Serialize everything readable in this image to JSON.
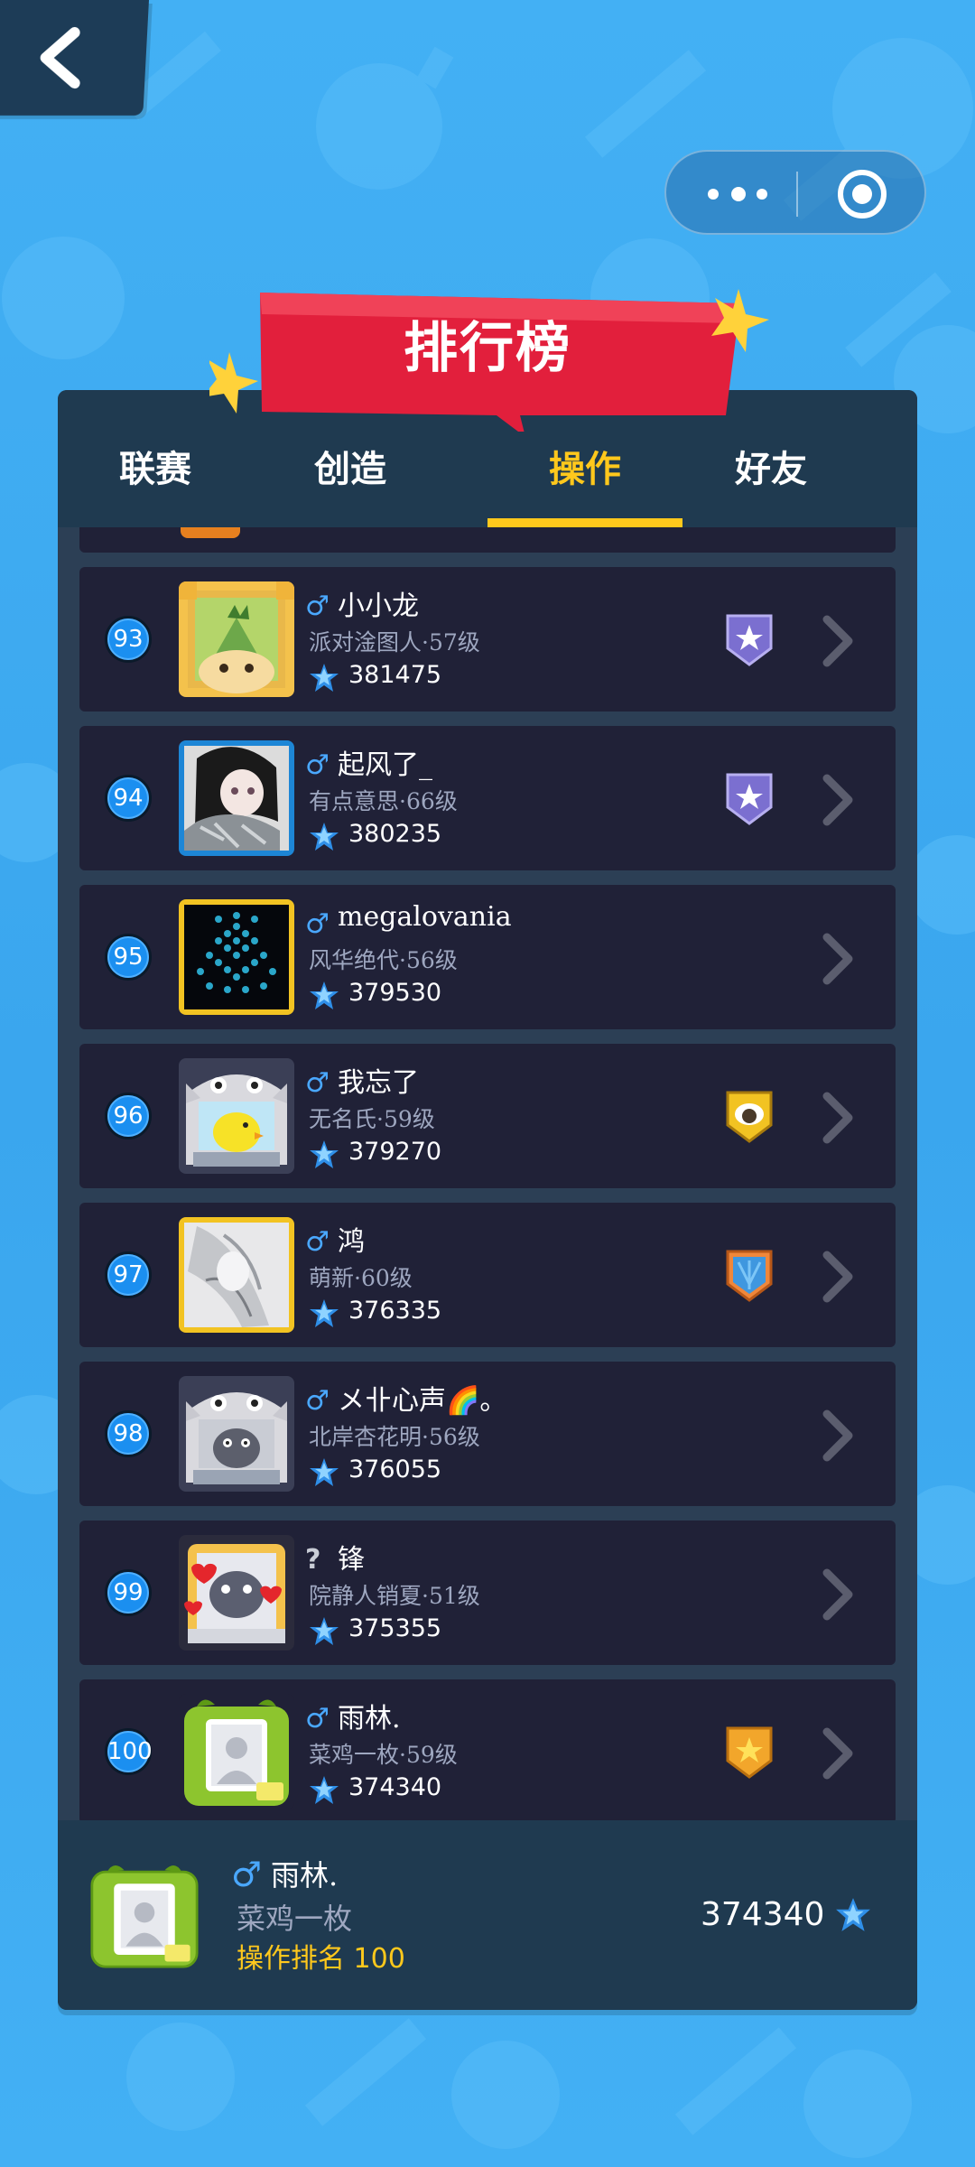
{
  "window": {
    "title": "排行榜"
  },
  "tabs": [
    {
      "label": "联赛",
      "active": false
    },
    {
      "label": "创造",
      "active": false
    },
    {
      "label": "操作",
      "active": true
    },
    {
      "label": "好友",
      "active": false
    }
  ],
  "colors": {
    "accent": "#ffc81c",
    "panel": "#2a3f55",
    "row": "#202137",
    "ribbon": "#e21f3c",
    "rank_badge": "#1b8ff0",
    "male": "#4aa8ff"
  },
  "icons": {
    "back": "back-arrow-icon",
    "more": "more-icon",
    "close": "close-target-icon",
    "score": "blue-star-icon",
    "chevron": "chevron-right-icon"
  },
  "rows": [
    {
      "rank": "93",
      "gender": "♂",
      "name": "小小龙",
      "level": "派对淦图人·57级",
      "score": "381475",
      "badge": "purple-star-shield",
      "avatar": "dino"
    },
    {
      "rank": "94",
      "gender": "♂",
      "name": "起风了_",
      "level": "有点意思·66级",
      "score": "380235",
      "badge": "purple-star-shield",
      "avatar": "photo-girl"
    },
    {
      "rank": "95",
      "gender": "♂",
      "name": "megalovania",
      "level": "风华绝代·56级",
      "score": "379530",
      "badge": "none",
      "avatar": "pixel-spider"
    },
    {
      "rank": "96",
      "gender": "♂",
      "name": "我忘了",
      "level": "无名氏·59级",
      "score": "379270",
      "badge": "gold-sheep-shield",
      "avatar": "cat-chick"
    },
    {
      "rank": "97",
      "gender": "♂",
      "name": "鸿",
      "level": "萌新·60级",
      "score": "376335",
      "badge": "blue-orange-shield",
      "avatar": "photo-sketch"
    },
    {
      "rank": "98",
      "gender": "♂",
      "name": "メ卝心声🌈。",
      "level": "北岸杏花明·56级",
      "score": "376055",
      "badge": "none",
      "avatar": "cat-raccoon"
    },
    {
      "rank": "99",
      "gender": "?",
      "name": "锋",
      "level": "院静人销夏·51级",
      "score": "375355",
      "badge": "none",
      "avatar": "hearts-raccoon"
    },
    {
      "rank": "100",
      "gender": "♂",
      "name": "雨林.",
      "level": "菜鸡一枚·59级",
      "score": "374340",
      "badge": "gold-star-shield",
      "avatar": "default-green"
    }
  ],
  "me": {
    "gender": "♂",
    "name": "雨林.",
    "level": "菜鸡一枚",
    "rank_label": "操作排名",
    "rank_value": "100",
    "score": "374340"
  }
}
